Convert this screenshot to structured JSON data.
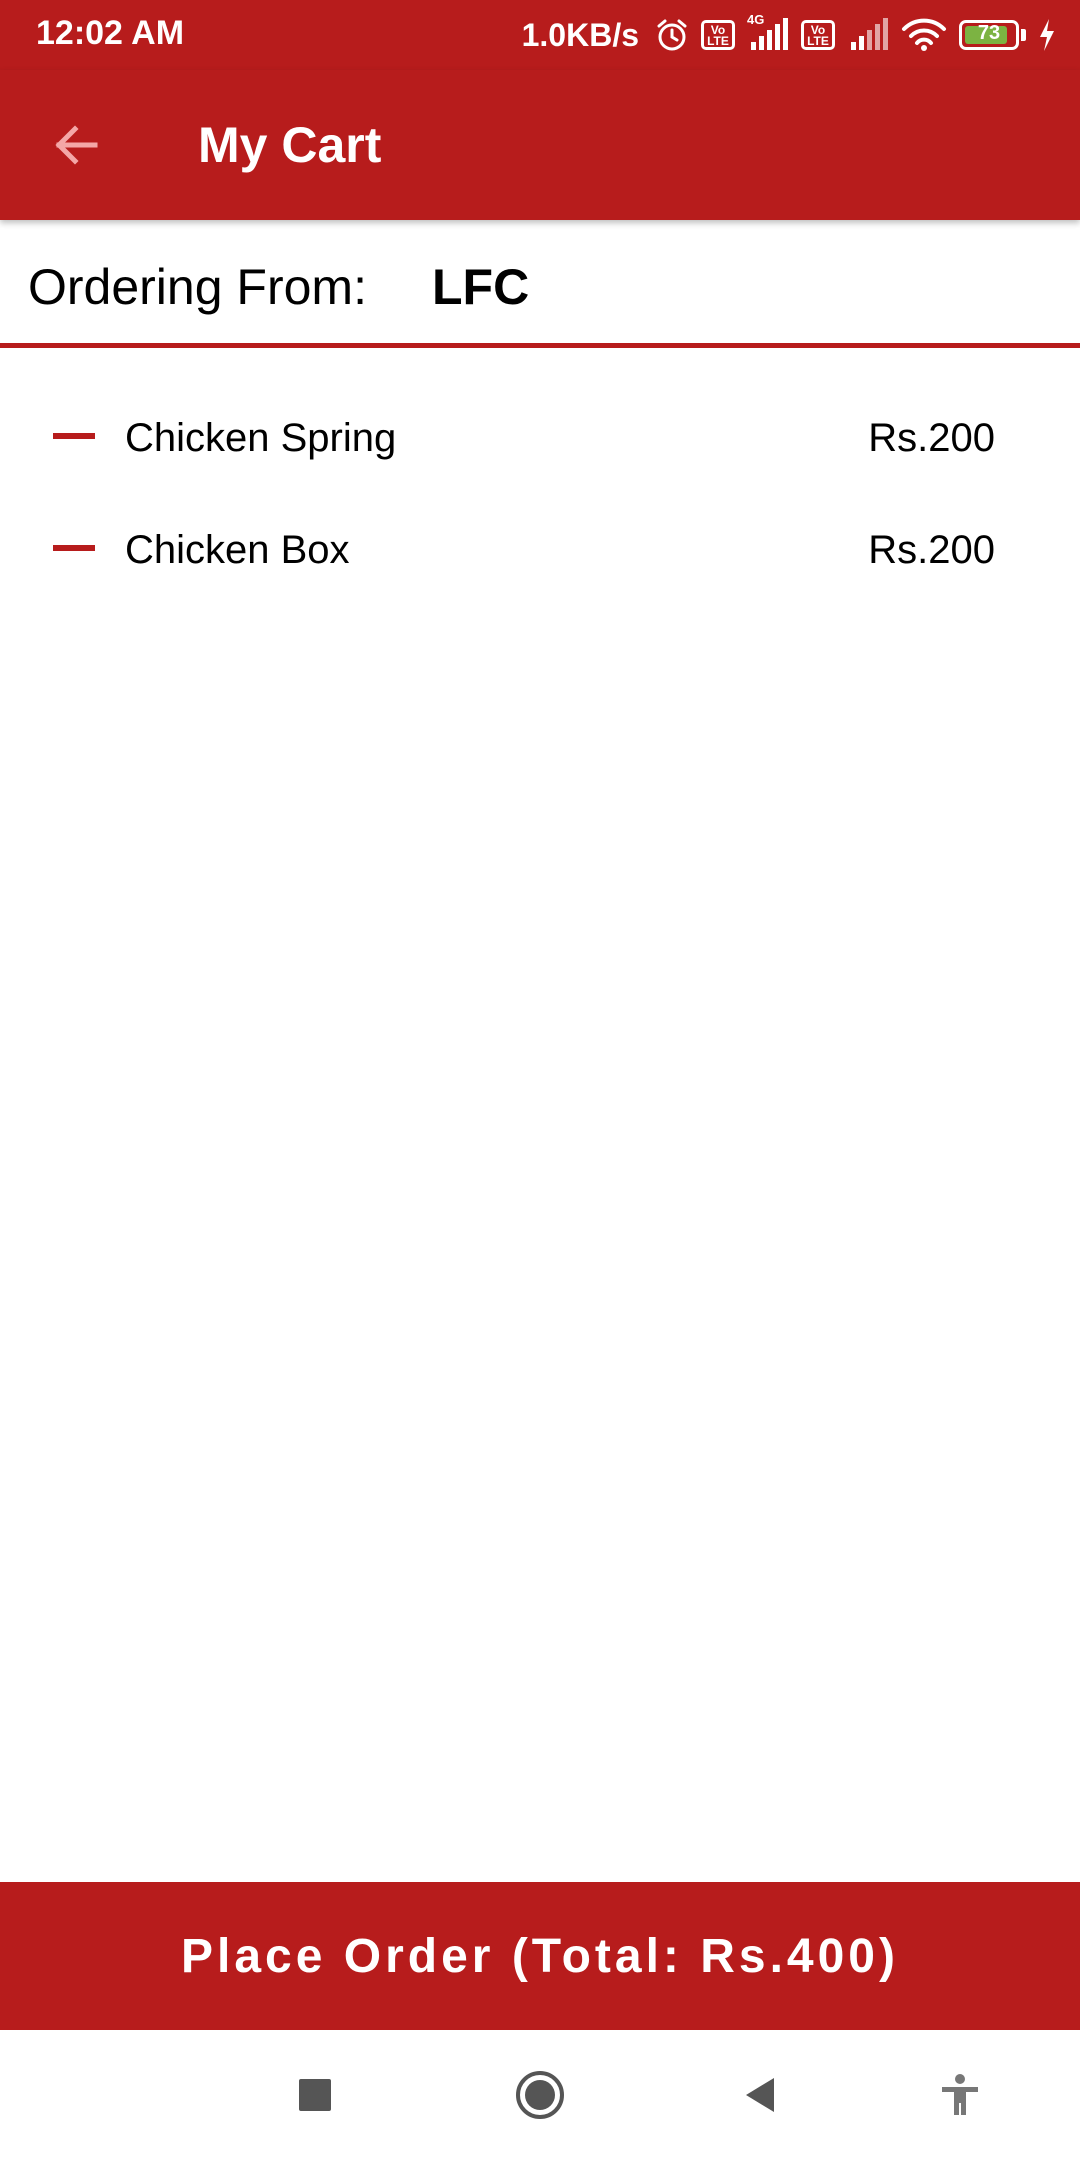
{
  "status_bar": {
    "time": "12:02 AM",
    "network_speed": "1.0KB/s",
    "network_type": "4G",
    "volte_label": "Vo LTE",
    "battery_level": "73",
    "icons": [
      "alarm-icon",
      "volte-icon",
      "signal-icon",
      "volte-icon",
      "signal-icon",
      "wifi-icon",
      "battery-icon",
      "charging-icon"
    ]
  },
  "app_bar": {
    "title": "My Cart",
    "back_icon": "arrow-back-icon"
  },
  "ordering": {
    "label": "Ordering From:",
    "restaurant": "LFC"
  },
  "cart": {
    "items": [
      {
        "name": "Chicken Spring",
        "price": "Rs.200",
        "remove_icon": "minus-icon"
      },
      {
        "name": "Chicken Box",
        "price": "Rs.200",
        "remove_icon": "minus-icon"
      }
    ]
  },
  "footer": {
    "place_order_label": "Place Order (Total: Rs.400)"
  },
  "nav_bar": {
    "icons": [
      "recents-square-icon",
      "home-circle-icon",
      "back-triangle-icon",
      "accessibility-icon"
    ]
  },
  "colors": {
    "primary": "#b71c1c",
    "text": "#000000",
    "background": "#ffffff",
    "battery_fill": "#7cb342"
  }
}
